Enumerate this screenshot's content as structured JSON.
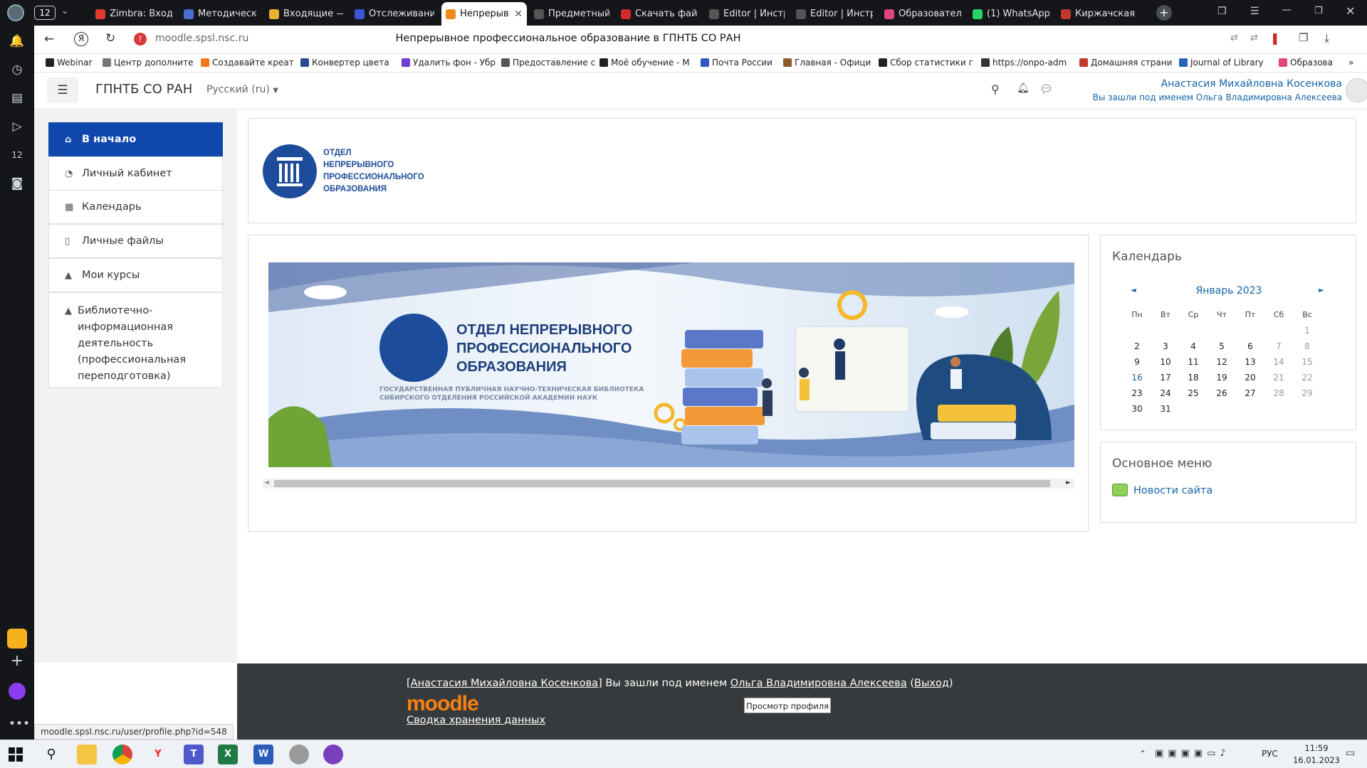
{
  "browser": {
    "tab_count_badge": "12",
    "tabs": [
      {
        "label": "Zimbra: Вход",
        "color": "#e23b2e"
      },
      {
        "label": "Методическ",
        "color": "#4a6fd1"
      },
      {
        "label": "Входящие —",
        "color": "#e8b22c"
      },
      {
        "label": "Отслеживани",
        "color": "#3a56d4"
      },
      {
        "label": "Непрерывн",
        "color": "#f28a18"
      },
      {
        "label": "Предметный",
        "color": "#555555"
      },
      {
        "label": "Скачать фай",
        "color": "#d42a2a"
      },
      {
        "label": "Editor | Инстр",
        "color": "#555555"
      },
      {
        "label": "Editor | Инстр",
        "color": "#555555"
      },
      {
        "label": "Образовател",
        "color": "#e0457b"
      },
      {
        "label": "(1) WhatsApp",
        "color": "#25d366"
      },
      {
        "label": "Киржачская",
        "color": "#c0392b"
      }
    ],
    "url": "moodle.spsl.nsc.ru",
    "page_title": "Непрерывное профессиональное образование в ГПНТБ СО РАН",
    "bookmarks": [
      {
        "label": "Webinar",
        "color": "#222222"
      },
      {
        "label": "Центр дополните",
        "color": "#777777"
      },
      {
        "label": "Создавайте креат",
        "color": "#f07818"
      },
      {
        "label": "Конвертер цвета",
        "color": "#2b4b8c"
      },
      {
        "label": "Удалить фон - Убр",
        "color": "#6a3fd1"
      },
      {
        "label": "Предоставление с",
        "color": "#555555"
      },
      {
        "label": "Моё обучение - М",
        "color": "#222222"
      },
      {
        "label": "Почта России",
        "color": "#2f56c6"
      },
      {
        "label": "Главная - Офици",
        "color": "#8a5a2b"
      },
      {
        "label": "Сбор статистики г",
        "color": "#222222"
      },
      {
        "label": "https://onpo-adm",
        "color": "#333333"
      },
      {
        "label": "Домашняя страни",
        "color": "#c0392b"
      },
      {
        "label": "Journal of Library",
        "color": "#2a64b8"
      },
      {
        "label": "Образова",
        "color": "#e0457b"
      }
    ],
    "status_url": "moodle.spsl.nsc.ru/user/profile.php?id=548"
  },
  "navbar": {
    "site_name": "ГПНТБ СО РАН",
    "language": "Русский (ru)",
    "user_name": "Анастасия Михайловна Косенкова",
    "logged_in_as": "Вы зашли под именем Ольга Владимировна Алексеева"
  },
  "sidebar": {
    "items": [
      {
        "label": "В начало",
        "icon": "home-icon",
        "active": true
      },
      {
        "label": "Личный кабинет",
        "icon": "dashboard-icon"
      },
      {
        "label": "Календарь",
        "icon": "calendar-icon"
      },
      {
        "label": "Личные файлы",
        "icon": "file-icon"
      },
      {
        "label": "Мои курсы",
        "icon": "graduation-cap-icon"
      },
      {
        "label": "Библиотечно-информационная деятельность (профессиональная переподготовка)",
        "icon": "graduation-cap-icon"
      }
    ]
  },
  "logo": {
    "lines": [
      "ОТДЕЛ",
      "НЕПРЕРЫВНОГО",
      "ПРОФЕССИОНАЛЬНОГО",
      "ОБРАЗОВАНИЯ"
    ]
  },
  "banner": {
    "title_lines": [
      "ОТДЕЛ НЕПРЕРЫВНОГО",
      "ПРОФЕССИОНАЛЬНОГО",
      "ОБРАЗОВАНИЯ"
    ],
    "subtitle_lines": [
      "ГОСУДАРСТВЕННАЯ ПУБЛИЧНАЯ НАУЧНО-ТЕХНИЧЕСКАЯ БИБЛИОТЕКА",
      "СИБИРСКОГО ОТДЕЛЕНИЯ РОССИЙСКОЙ АКАДЕМИИ НАУК"
    ]
  },
  "calendar": {
    "title": "Календарь",
    "month": "Январь 2023",
    "prev": "◄",
    "next": "►",
    "weekdays": [
      "Пн",
      "Вт",
      "Ср",
      "Чт",
      "Пт",
      "Сб",
      "Вс"
    ],
    "weeks": [
      [
        "",
        "",
        "",
        "",
        "",
        "",
        "1"
      ],
      [
        "2",
        "3",
        "4",
        "5",
        "6",
        "7",
        "8"
      ],
      [
        "9",
        "10",
        "11",
        "12",
        "13",
        "14",
        "15"
      ],
      [
        "16",
        "17",
        "18",
        "19",
        "20",
        "21",
        "22"
      ],
      [
        "23",
        "24",
        "25",
        "26",
        "27",
        "28",
        "29"
      ],
      [
        "30",
        "31",
        "",
        "",
        "",
        "",
        ""
      ]
    ]
  },
  "main_menu": {
    "title": "Основное меню",
    "item": "Новости сайта"
  },
  "footer": {
    "user_link": "Анастасия Михайловна Косенкова",
    "logged_text": "Вы зашли под именем",
    "as_user": "Ольга Владимировна Алексеева",
    "logout": "Выход",
    "moodle_logo": "moodle",
    "data_summary": "Сводка хранения данных",
    "view_profile_btn": "Просмотр профиля"
  },
  "taskbar": {
    "language": "РУС",
    "time": "11:59",
    "date": "16.01.2023"
  }
}
